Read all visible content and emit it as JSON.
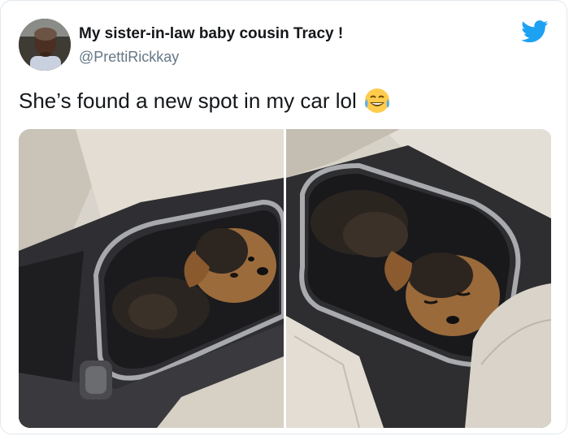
{
  "tweet": {
    "author_name": "My sister-in-law baby cousin Tracy !",
    "author_handle": "@PrettiRickkay",
    "text": "She’s found a new spot in my car lol",
    "emoji": "face-with-tears-of-joy",
    "media": [
      {
        "name": "photo-puppy-cupholder-left"
      },
      {
        "name": "photo-puppy-cupholder-right"
      }
    ]
  },
  "colors": {
    "twitter_blue": "#1da1f2",
    "handle_gray": "#657786",
    "text_dark": "#14171a"
  }
}
